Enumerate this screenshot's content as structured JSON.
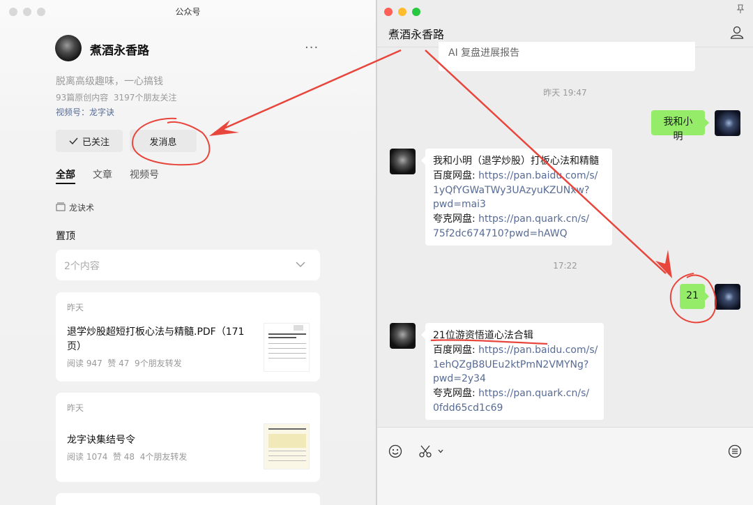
{
  "left_window": {
    "title": "公众号",
    "account": {
      "name": "煮酒永香路",
      "bio": "脱离高级趣味，一心搞钱",
      "stats": "93篇原创内容  3197个朋友关注",
      "channel": "视频号：龙字诀"
    },
    "buttons": {
      "followed": "已关注",
      "message": "发消息"
    },
    "tabs": [
      "全部",
      "文章",
      "视频号"
    ],
    "album": "龙诀术",
    "pinned": {
      "title": "置顶",
      "dropdown": "2个内容"
    },
    "articles": [
      {
        "date": "昨天",
        "title": "退学炒股超短打板心法与精髓.PDF（171页）",
        "meta": "阅读 947  赞 47  9个朋友转发"
      },
      {
        "date": "昨天",
        "title": "龙字诀集结号令",
        "meta": "阅读 1074  赞 48  4个朋友转发"
      }
    ]
  },
  "right_window": {
    "chat_title": "煮酒永香路",
    "messages": {
      "prev_snippet": "AI 复盘进展报告",
      "time1": "昨天 19:47",
      "me1": "我和小明",
      "reply1": {
        "title": "我和小明（退学炒股）打板心法和精髓",
        "baidu_label": "百度网盘: ",
        "baidu_link_1": "https://pan.baidu.com/s/",
        "baidu_link_2": "1yQfYGWaTWy3UAzyuKZUNxw?",
        "baidu_link_3": "pwd=mai3",
        "quark_label": "夸克网盘: ",
        "quark_link_1": "https://pan.quark.cn/s/",
        "quark_link_2": "75f2dc674710?pwd=hAWQ"
      },
      "time2": "17:22",
      "me2": "21",
      "reply2": {
        "title": "21位游资悟道心法合辑",
        "baidu_label": "百度网盘: ",
        "baidu_link_1": "https://pan.baidu.com/s/",
        "baidu_link_2": "1ehQZgB8UEu2ktPmN2VMYNg?",
        "baidu_link_3": "pwd=2y34",
        "quark_label": "夸克网盘: ",
        "quark_link_1": "https://pan.quark.cn/s/",
        "quark_link_2": "0fdd65cd1c69"
      }
    }
  },
  "colors": {
    "annotation_red": "#e8453c",
    "bubble_green": "#95ec69",
    "link_blue": "#576b95"
  }
}
